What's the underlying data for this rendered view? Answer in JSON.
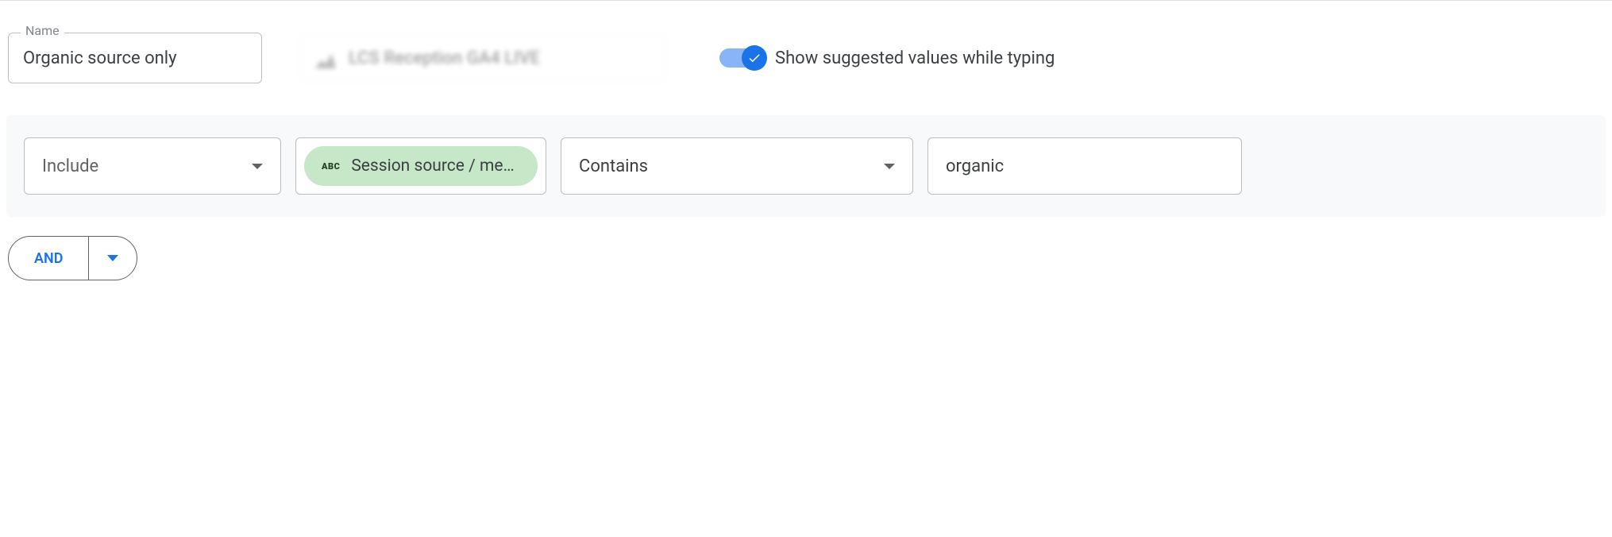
{
  "nameField": {
    "label": "Name",
    "value": "Organic source only"
  },
  "propertyBlurred": {
    "text": "LCS Reception GA4 LIVE"
  },
  "suggestToggle": {
    "label": "Show suggested values while typing",
    "checked": true
  },
  "condition": {
    "includeExclude": "Include",
    "dimensionChip": "Session source / medi…",
    "matchType": "Contains",
    "value": "organic"
  },
  "logic": {
    "andLabel": "AND"
  }
}
